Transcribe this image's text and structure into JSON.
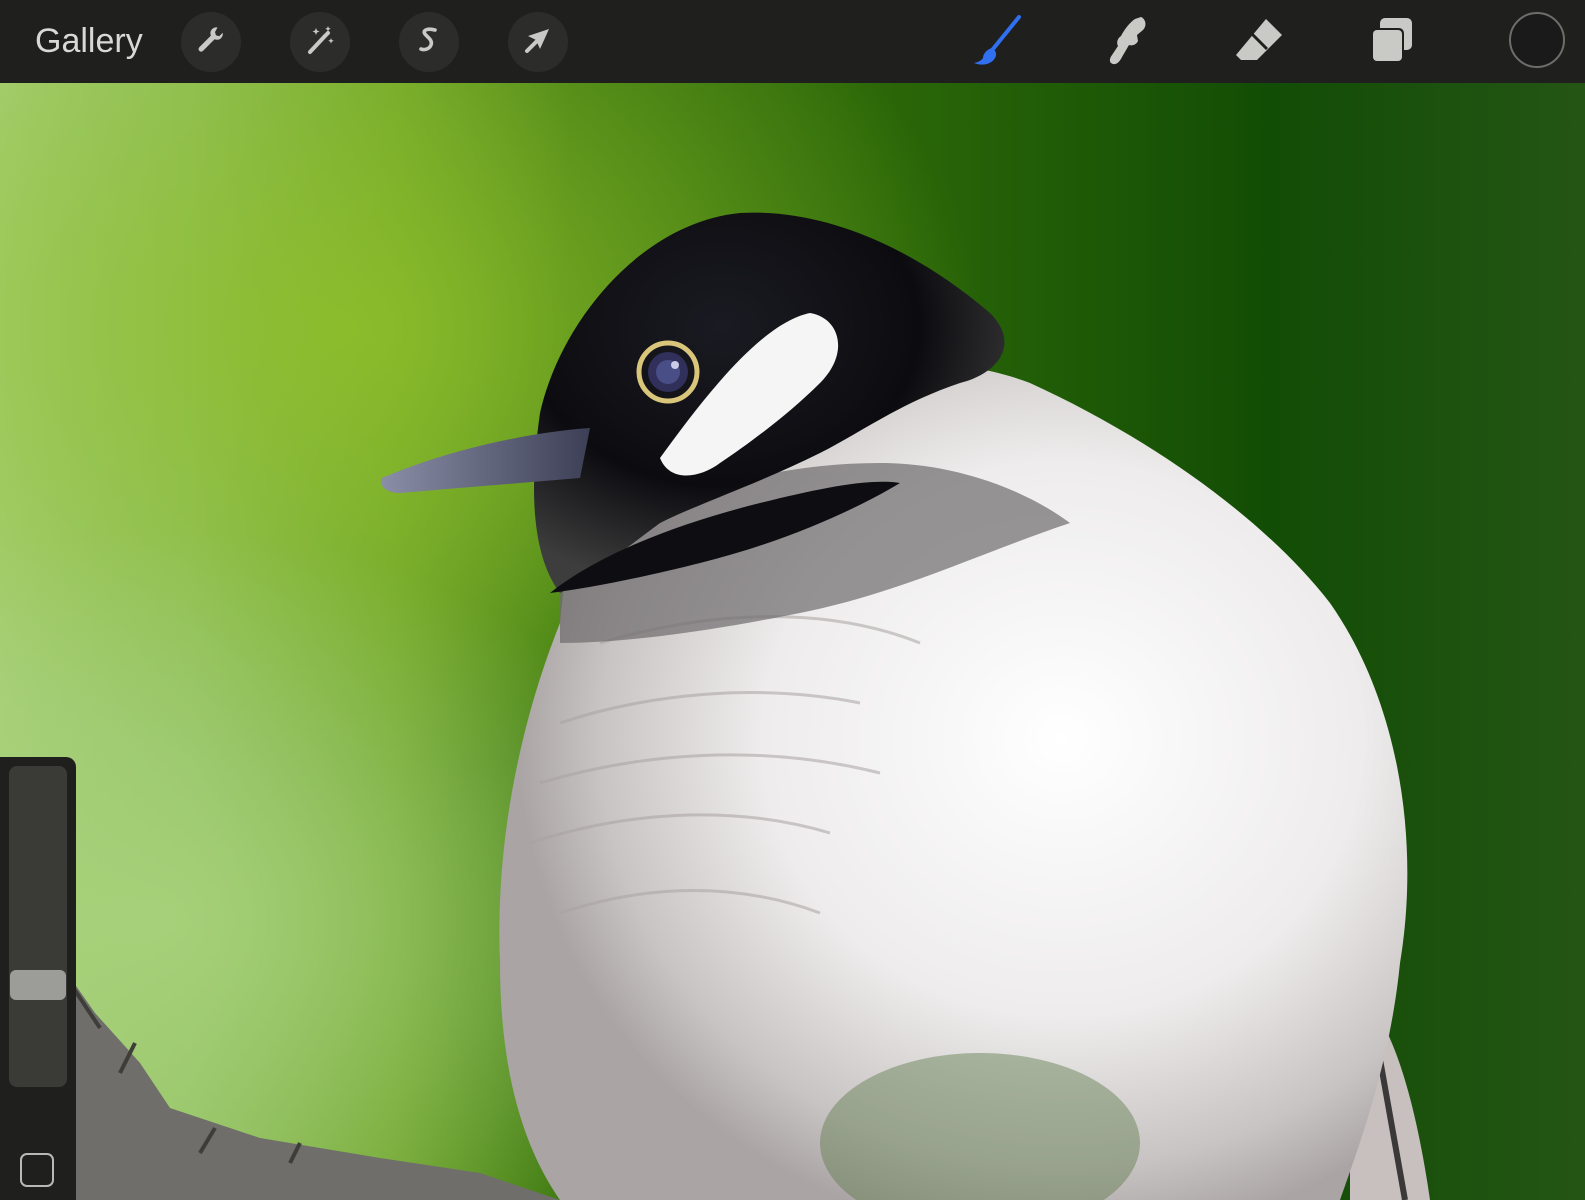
{
  "toolbar": {
    "gallery_label": "Gallery",
    "left_tools": [
      {
        "name": "actions",
        "icon": "wrench-icon"
      },
      {
        "name": "adjustments",
        "icon": "magic-wand-icon"
      },
      {
        "name": "selection",
        "icon": "selection-s-icon"
      },
      {
        "name": "transform",
        "icon": "arrow-cursor-icon"
      }
    ],
    "right_tools": [
      {
        "name": "brush",
        "icon": "brush-icon",
        "active": true
      },
      {
        "name": "smudge",
        "icon": "smudge-finger-icon",
        "active": false
      },
      {
        "name": "eraser",
        "icon": "eraser-icon",
        "active": false
      },
      {
        "name": "layers",
        "icon": "layers-icon",
        "active": false
      }
    ],
    "current_color": "#1a1a1a"
  },
  "sidebar": {
    "brush_size_level": 0.3,
    "modify_button_icon": "square-icon"
  },
  "colors": {
    "toolbar_bg": "#1f201d",
    "active_tool": "#2f6ff0",
    "icon_gray": "#c9cac6",
    "background_green_light": "#9bc76a",
    "background_green_dark": "#0f4a07"
  },
  "canvas": {
    "subject": "painting"
  }
}
